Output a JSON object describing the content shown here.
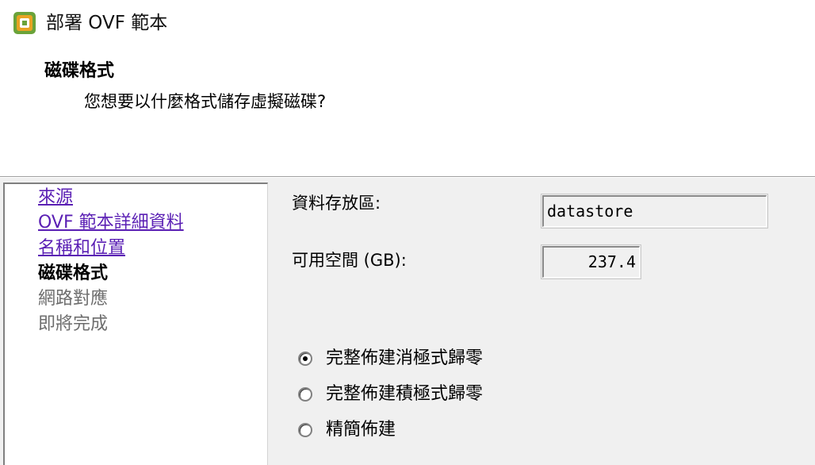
{
  "window": {
    "title": "部署 OVF 範本"
  },
  "header": {
    "title": "磁碟格式",
    "question": "您想要以什麼格式儲存虛擬磁碟?"
  },
  "nav": {
    "items": [
      {
        "label": "來源",
        "state": "link"
      },
      {
        "label": "OVF 範本詳細資料",
        "state": "link"
      },
      {
        "label": "名稱和位置",
        "state": "link"
      },
      {
        "label": "磁碟格式",
        "state": "current"
      },
      {
        "label": "網路對應",
        "state": "disabled"
      },
      {
        "label": "即將完成",
        "state": "disabled"
      }
    ]
  },
  "fields": {
    "datastore_label": "資料存放區:",
    "datastore_value": "datastore",
    "free_space_label": "可用空間 (GB):",
    "free_space_value": "237.4"
  },
  "disk_format": {
    "options": [
      {
        "label": "完整佈建消極式歸零",
        "checked": true
      },
      {
        "label": "完整佈建積極式歸零",
        "checked": false
      },
      {
        "label": "精簡佈建",
        "checked": false
      }
    ]
  },
  "colors": {
    "link": "#5a1fb4",
    "disabled_text": "#6d6d6d",
    "panel_bg": "#f0f0f0"
  }
}
